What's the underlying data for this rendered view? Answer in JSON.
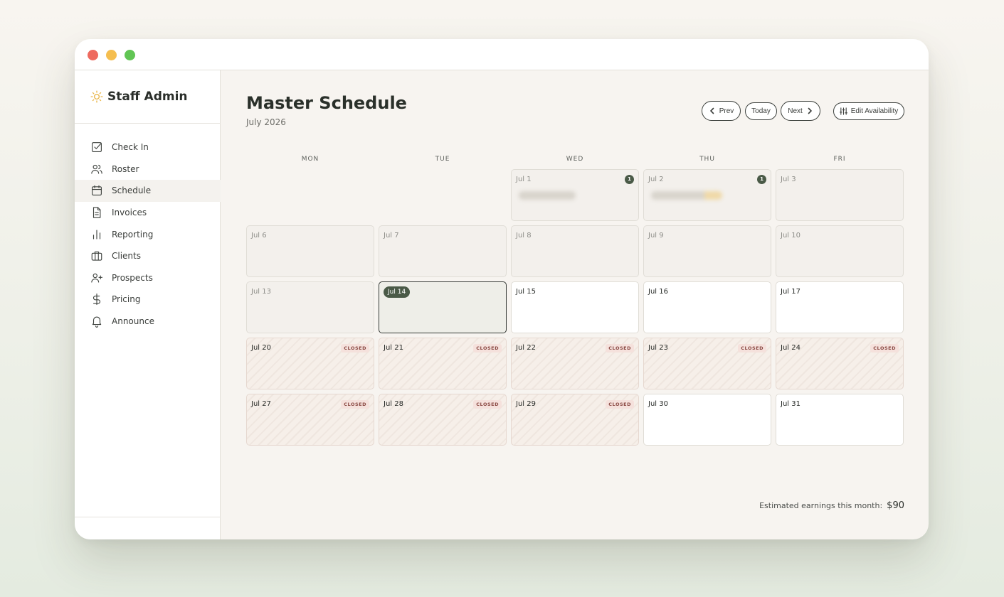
{
  "window": {
    "controls": [
      "close",
      "minimize",
      "maximize"
    ]
  },
  "sidebar": {
    "brand": {
      "icon": "sun-icon",
      "title": "Staff Admin"
    },
    "items": [
      {
        "label": "Check In",
        "icon": "check-square-icon",
        "active": false
      },
      {
        "label": "Roster",
        "icon": "users-icon",
        "active": false
      },
      {
        "label": "Schedule",
        "icon": "calendar-icon",
        "active": true
      },
      {
        "label": "Invoices",
        "icon": "document-icon",
        "active": false
      },
      {
        "label": "Reporting",
        "icon": "bar-chart-icon",
        "active": false
      },
      {
        "label": "Clients",
        "icon": "briefcase-icon",
        "active": false
      },
      {
        "label": "Prospects",
        "icon": "user-plus-icon",
        "active": false
      },
      {
        "label": "Pricing",
        "icon": "dollar-icon",
        "active": false
      },
      {
        "label": "Announce",
        "icon": "bell-icon",
        "active": false
      }
    ]
  },
  "header": {
    "title": "Master Schedule",
    "subtitle": "July 2026",
    "buttons": {
      "prev": "Prev",
      "today": "Today",
      "next": "Next",
      "edit": "Edit Availability"
    }
  },
  "calendar": {
    "weekdays": [
      "MON",
      "TUE",
      "WED",
      "THU",
      "FRI"
    ],
    "closed_label": "CLOSED",
    "weeks": [
      [
        null,
        null,
        {
          "label": "Jul 1",
          "state": "past",
          "count": "1",
          "events": 1
        },
        {
          "label": "Jul 2",
          "state": "past",
          "count": "1",
          "events": 1
        },
        {
          "label": "Jul 3",
          "state": "past"
        }
      ],
      [
        {
          "label": "Jul 6",
          "state": "past"
        },
        {
          "label": "Jul 7",
          "state": "past"
        },
        {
          "label": "Jul 8",
          "state": "past"
        },
        {
          "label": "Jul 9",
          "state": "past"
        },
        {
          "label": "Jul 10",
          "state": "past"
        }
      ],
      [
        {
          "label": "Jul 13",
          "state": "past"
        },
        {
          "label": "Jul 14",
          "state": "today"
        },
        {
          "label": "Jul 15",
          "state": "open"
        },
        {
          "label": "Jul 16",
          "state": "open"
        },
        {
          "label": "Jul 17",
          "state": "open"
        }
      ],
      [
        {
          "label": "Jul 20",
          "state": "closed"
        },
        {
          "label": "Jul 21",
          "state": "closed"
        },
        {
          "label": "Jul 22",
          "state": "closed"
        },
        {
          "label": "Jul 23",
          "state": "closed"
        },
        {
          "label": "Jul 24",
          "state": "closed"
        }
      ],
      [
        {
          "label": "Jul 27",
          "state": "closed"
        },
        {
          "label": "Jul 28",
          "state": "closed"
        },
        {
          "label": "Jul 29",
          "state": "closed"
        },
        {
          "label": "Jul 30",
          "state": "open"
        },
        {
          "label": "Jul 31",
          "state": "open"
        }
      ]
    ]
  },
  "footer": {
    "earnings_label": "Estimated earnings this month:",
    "earnings_value": "$90"
  },
  "colors": {
    "accent": "#4a5a47",
    "closed_badge_bg": "#f5e1dc",
    "closed_badge_text": "#8b4a44",
    "window_bg": "#f7f4f0"
  }
}
